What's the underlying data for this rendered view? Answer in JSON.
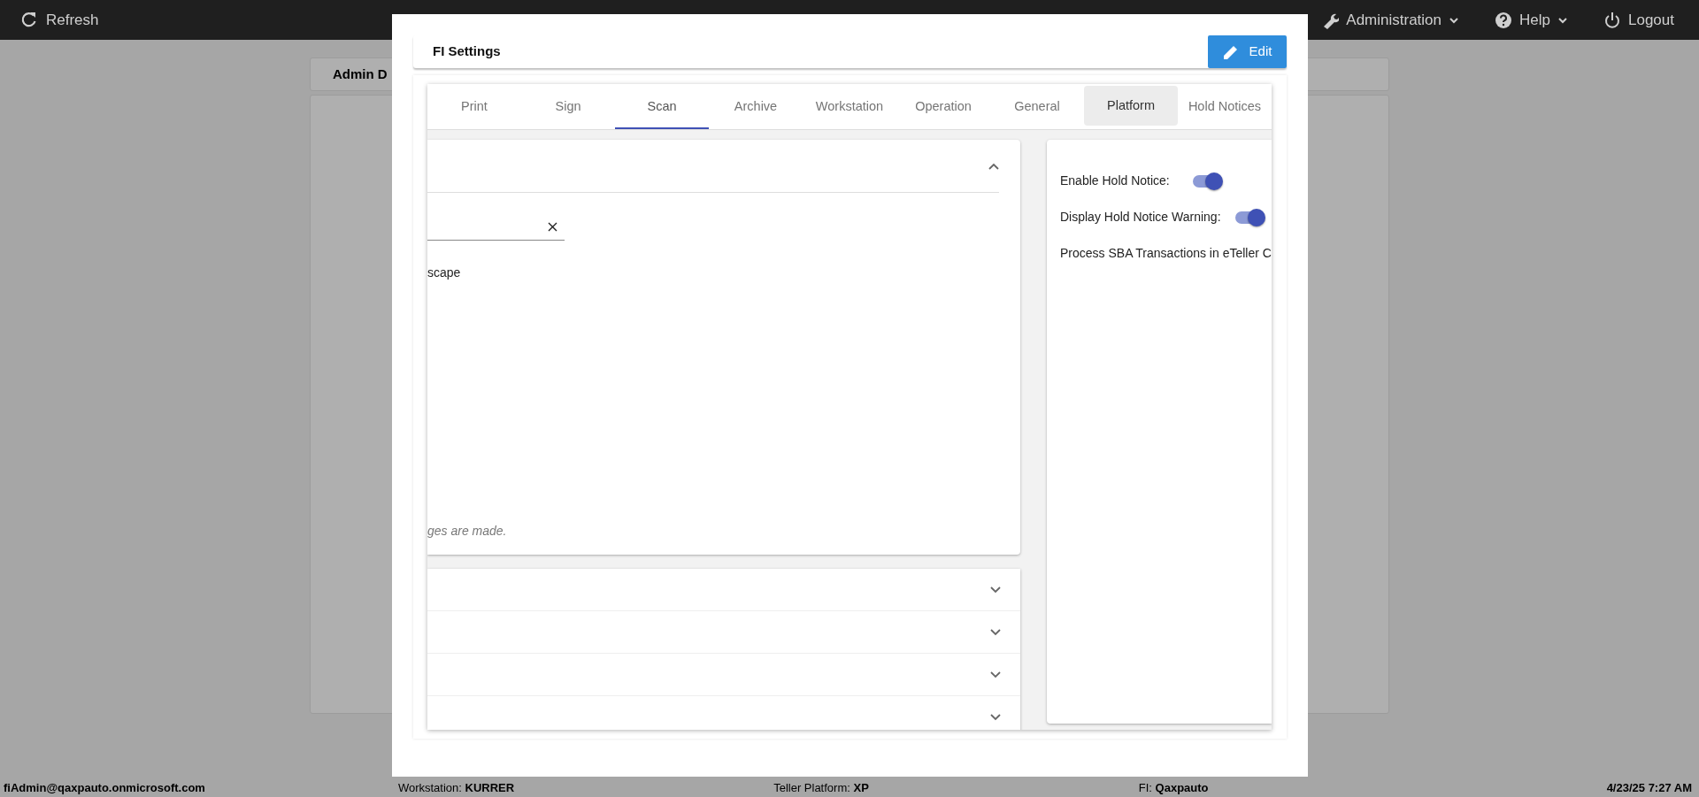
{
  "top_bar": {
    "items": [
      {
        "kind": "link",
        "label": "Refresh"
      },
      {
        "kind": "menu",
        "label": "Administration"
      },
      {
        "kind": "menu",
        "label": "Help"
      },
      {
        "kind": "link",
        "label": "Logout"
      }
    ]
  },
  "background_page": {
    "tab_label": "Admin D"
  },
  "modal": {
    "title": "FI Settings",
    "edit_button": "Edit",
    "tabs": [
      {
        "label": "Print",
        "selected": false,
        "highlighted": false
      },
      {
        "label": "Sign",
        "selected": false,
        "highlighted": false
      },
      {
        "label": "Scan",
        "selected": true,
        "highlighted": false
      },
      {
        "label": "Archive",
        "selected": false,
        "highlighted": false
      },
      {
        "label": "Workstation",
        "selected": false,
        "highlighted": false
      },
      {
        "label": "Operation",
        "selected": false,
        "highlighted": false
      },
      {
        "label": "General",
        "selected": false,
        "highlighted": false
      },
      {
        "label": "Platform",
        "selected": false,
        "highlighted": true
      },
      {
        "label": "Hold Notices",
        "selected": false,
        "highlighted": false
      }
    ],
    "main_section": {
      "expanded": true,
      "option_text": "scape",
      "note": "ges are made."
    },
    "sections": [
      {
        "expanded": false
      },
      {
        "expanded": false
      },
      {
        "expanded": false
      },
      {
        "expanded": false
      }
    ],
    "hold_notice_settings": [
      {
        "kind": "toggle",
        "label": "Enable Hold Notice:",
        "on": true
      },
      {
        "kind": "toggle",
        "label": "Display Hold Notice Warning:",
        "on": true
      },
      {
        "kind": "text",
        "label": "Process SBA Transactions in eTeller C"
      }
    ]
  },
  "status_bar": {
    "user": "fiAdmin@qaxpauto.onmicrosoft.com",
    "workstation": "Workstation: **KURRER**",
    "platform": "Teller Platform: **XP**",
    "fi": "FI: **Qaxpauto**",
    "datetime": "4/23/25 7:27 AM"
  }
}
